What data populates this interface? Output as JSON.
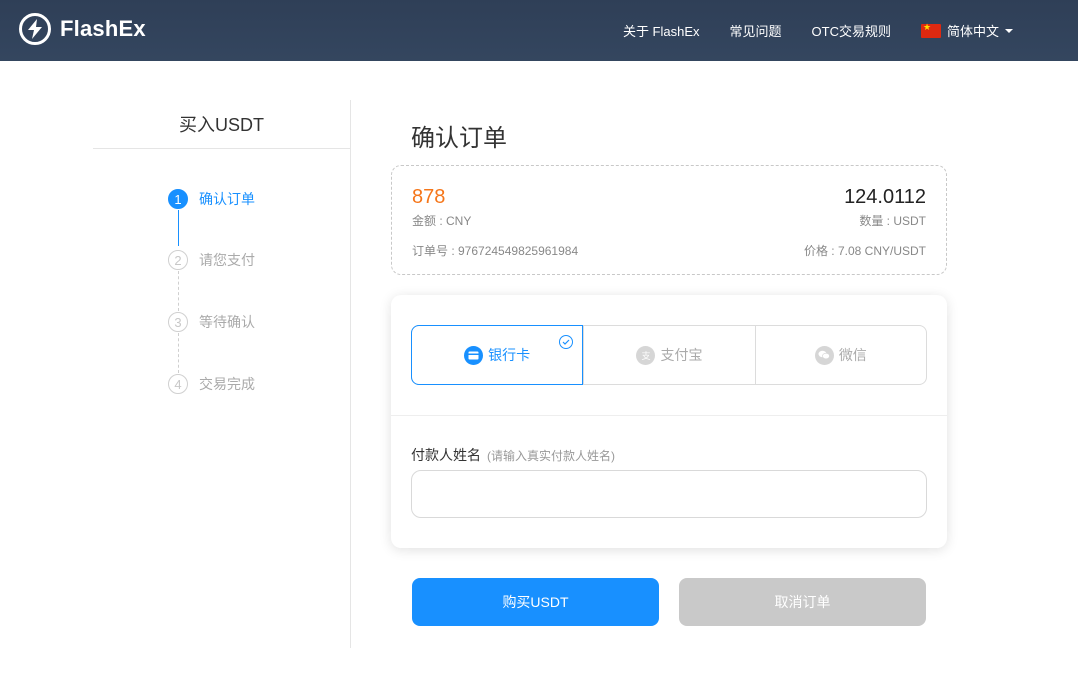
{
  "brand": {
    "name": "FlashEx"
  },
  "nav": {
    "items": [
      "关于 FlashEx",
      "常见问题",
      "OTC交易规则"
    ],
    "language": "简体中文"
  },
  "sidebar": {
    "title": "买入USDT",
    "steps": [
      {
        "num": "1",
        "label": "确认订单"
      },
      {
        "num": "2",
        "label": "请您支付"
      },
      {
        "num": "3",
        "label": "等待确认"
      },
      {
        "num": "4",
        "label": "交易完成"
      }
    ]
  },
  "main": {
    "title": "确认订单",
    "order": {
      "amount": "878",
      "amount_label": "金额 : CNY",
      "quantity": "124.0112",
      "quantity_label": "数量 : USDT",
      "order_no": "订单号 : 976724549825961984",
      "price": "价格 : 7.08 CNY/USDT"
    },
    "payment": {
      "methods": [
        "银行卡",
        "支付宝",
        "微信"
      ],
      "payer_label": "付款人姓名",
      "payer_hint": "(请输入真实付款人姓名)",
      "payer_value": ""
    },
    "buttons": {
      "buy": "购买USDT",
      "cancel": "取消订单"
    }
  },
  "colors": {
    "primary": "#1890ff",
    "amount": "#f5761a",
    "header": "#2f3f57",
    "disabled": "#c9c9c9"
  }
}
